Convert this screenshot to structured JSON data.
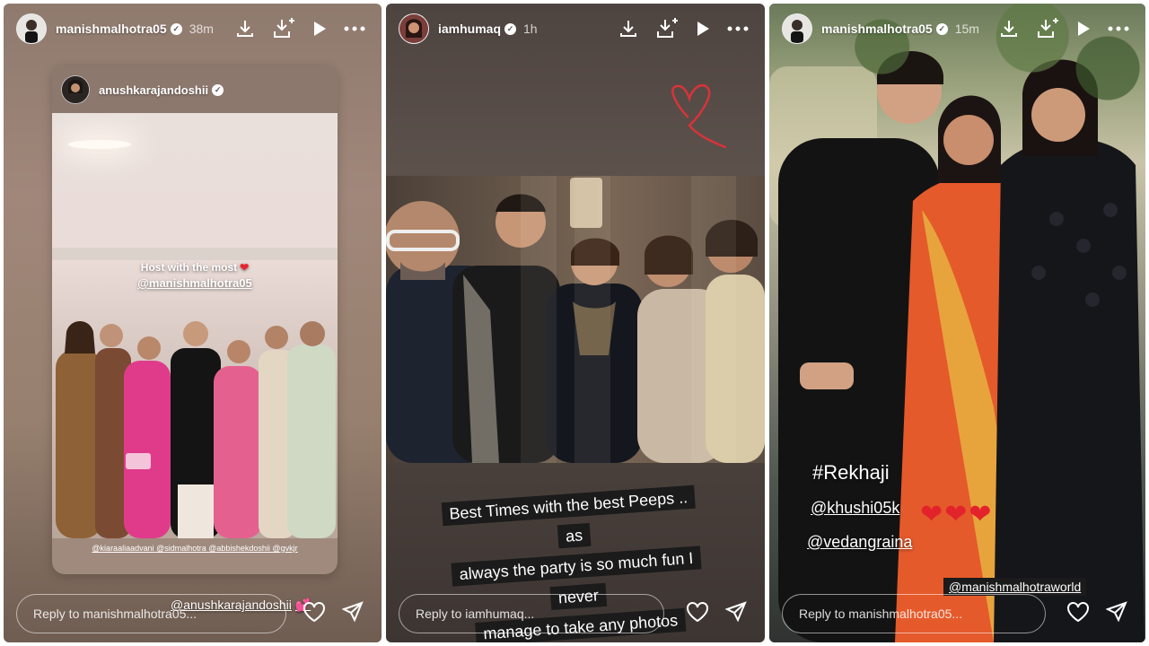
{
  "panels": [
    {
      "username": "manishmalhotra05",
      "time": "38m",
      "reply_placeholder": "Reply to manishmalhotra05...",
      "repost": {
        "username": "anushkarajandoshii",
        "host_line": "Host with the most",
        "host_mention": "@manishmalhotra05",
        "tags": "@kiaraaliaadvani @sidmalhotra @abbishekdoshii @gvkjr"
      },
      "mention_sticker": "@anushkarajandoshii"
    },
    {
      "username": "iamhumaq",
      "time": "1h",
      "reply_placeholder": "Reply to iamhumaq...",
      "caption_lines": [
        "Best Times with the best Peeps .. as",
        "always the party is so much fun I never",
        "manage to take any photos"
      ]
    },
    {
      "username": "manishmalhotra05",
      "time": "15m",
      "reply_placeholder": "Reply to manishmalhotra05...",
      "hashtag": "#Rekhaji",
      "mention_1": "@khushi05k",
      "mention_2": "@vedangraina",
      "mention_3": "@manishmalhotraworld",
      "hearts": "❤❤❤"
    }
  ],
  "icons": {
    "verified": "verified-badge-icon",
    "download": "download-icon",
    "save": "save-to-device-icon",
    "play": "play-icon",
    "more": "more-options-icon",
    "like": "heart-icon",
    "share": "send-icon"
  }
}
